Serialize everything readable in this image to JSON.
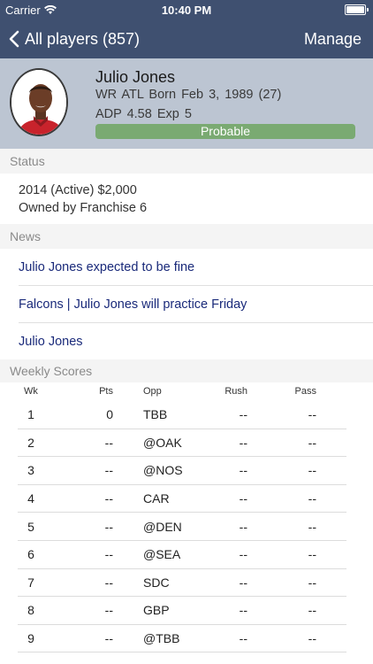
{
  "status_bar": {
    "carrier": "Carrier",
    "time": "10:40 PM"
  },
  "nav": {
    "back_label": "All players (857)",
    "right_label": "Manage"
  },
  "player": {
    "name": "Julio Jones",
    "position": "WR",
    "team": "ATL",
    "born": "Born Feb 3, 1989 (27)",
    "adp": "ADP 4.58",
    "exp": "Exp 5",
    "injury_status": "Probable"
  },
  "sections": {
    "status": "Status",
    "news": "News",
    "weekly": "Weekly Scores"
  },
  "status": {
    "contract": "2014 (Active) $2,000",
    "owner": "Owned by Franchise 6"
  },
  "news": [
    "Julio Jones expected to be fine",
    "Falcons | Julio Jones will practice Friday",
    "Julio Jones"
  ],
  "weekly": {
    "headers": {
      "wk": "Wk",
      "pts": "Pts",
      "opp": "Opp",
      "rush": "Rush",
      "pass": "Pass"
    },
    "rows": [
      {
        "wk": "1",
        "pts": "0",
        "opp": "TBB",
        "rush": "--",
        "pass": "--"
      },
      {
        "wk": "2",
        "pts": "--",
        "opp": "@OAK",
        "rush": "--",
        "pass": "--"
      },
      {
        "wk": "3",
        "pts": "--",
        "opp": "@NOS",
        "rush": "--",
        "pass": "--"
      },
      {
        "wk": "4",
        "pts": "--",
        "opp": "CAR",
        "rush": "--",
        "pass": "--"
      },
      {
        "wk": "5",
        "pts": "--",
        "opp": "@DEN",
        "rush": "--",
        "pass": "--"
      },
      {
        "wk": "6",
        "pts": "--",
        "opp": "@SEA",
        "rush": "--",
        "pass": "--"
      },
      {
        "wk": "7",
        "pts": "--",
        "opp": "SDC",
        "rush": "--",
        "pass": "--"
      },
      {
        "wk": "8",
        "pts": "--",
        "opp": "GBP",
        "rush": "--",
        "pass": "--"
      },
      {
        "wk": "9",
        "pts": "--",
        "opp": "@TBB",
        "rush": "--",
        "pass": "--"
      }
    ]
  },
  "colors": {
    "nav": "#3f5070",
    "header": "#bcc5d2",
    "probable": "#7aaa72",
    "link": "#1a2a7a"
  }
}
